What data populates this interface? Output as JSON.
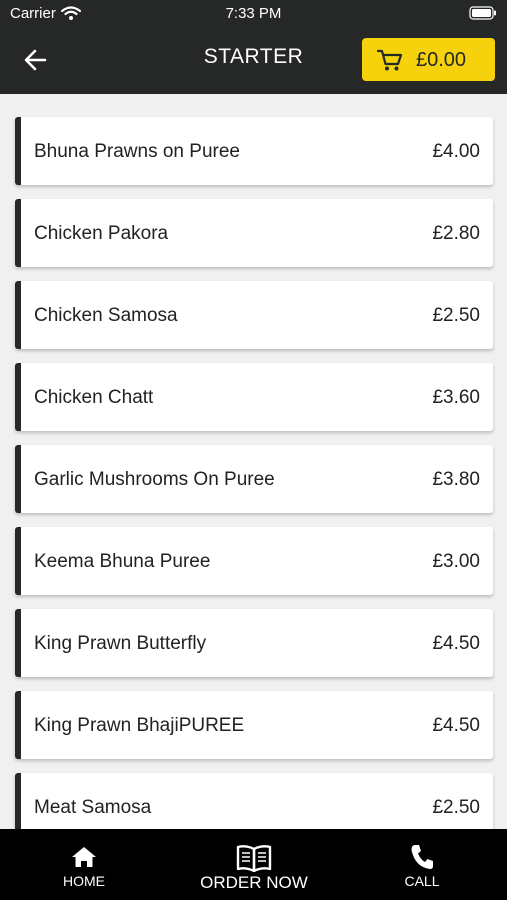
{
  "status_bar": {
    "carrier": "Carrier",
    "time": "7:33 PM"
  },
  "header": {
    "title": "STARTER",
    "cart_total": "£0.00"
  },
  "colors": {
    "header_bg": "#252826",
    "accent": "#f5d20c",
    "tab_bar_bg": "#000000"
  },
  "icons": [
    "wifi-icon",
    "battery-icon",
    "back-arrow-icon",
    "cart-icon",
    "home-icon",
    "menu-book-icon",
    "phone-icon"
  ],
  "menu_items": [
    {
      "name": "Bhuna Prawns on Puree",
      "price": "£4.00"
    },
    {
      "name": "Chicken Pakora",
      "price": "£2.80"
    },
    {
      "name": "Chicken Samosa",
      "price": "£2.50"
    },
    {
      "name": "Chicken Chatt",
      "price": "£3.60"
    },
    {
      "name": "Garlic Mushrooms On Puree",
      "price": "£3.80"
    },
    {
      "name": "Keema Bhuna Puree",
      "price": "£3.00"
    },
    {
      "name": "King Prawn Butterfly",
      "price": "£4.50"
    },
    {
      "name": "King Prawn BhajiPUREE",
      "price": "£4.50"
    },
    {
      "name": "Meat Samosa",
      "price": "£2.50"
    }
  ],
  "tab_bar": {
    "home": "HOME",
    "order_now": "ORDER NOW",
    "call": "CALL"
  }
}
